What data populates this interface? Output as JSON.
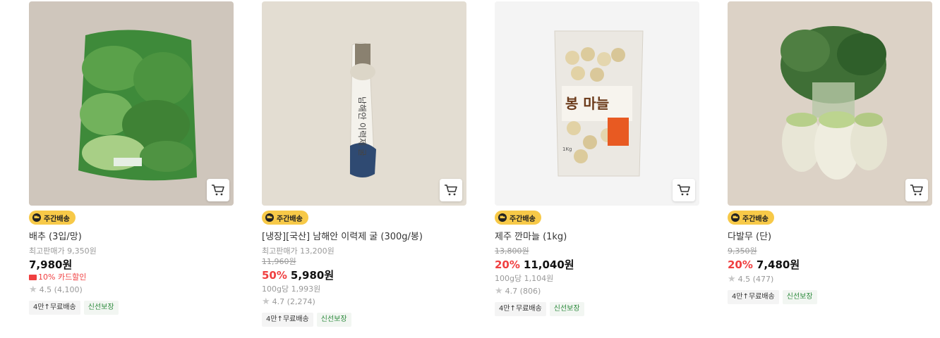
{
  "badge_label": "주간배송",
  "products": [
    {
      "name": "배추 (3입/망)",
      "ref_price": "최고판매가 9,350원",
      "price": "7,980원",
      "card_discount": "10% 카드할인",
      "rating": "4.5",
      "reviews": "(4,100)",
      "tags": [
        "4만↑무료배송",
        "신선보장"
      ]
    },
    {
      "name": "[냉장][국산] 남해안 이력제 굴 (300g/봉)",
      "ref_price": "최고판매가 13,200원",
      "original_price": "11,960원",
      "discount": "50%",
      "price": "5,980원",
      "unit_price": "100g당 1,993원",
      "rating": "4.7",
      "reviews": "(2,274)",
      "tags": [
        "4만↑무료배송",
        "신선보장"
      ],
      "package_text": "남해안 이력제 굴"
    },
    {
      "name": "제주 깐마늘 (1kg)",
      "original_price": "13,800원",
      "discount": "20%",
      "price": "11,040원",
      "unit_price": "100g당 1,104원",
      "rating": "4.7",
      "reviews": "(806)",
      "tags": [
        "4만↑무료배송",
        "신선보장"
      ],
      "package_text": "봉 마늘",
      "package_weight": "1Kg"
    },
    {
      "name": "다발무 (단)",
      "original_price": "9,350원",
      "discount": "20%",
      "price": "7,480원",
      "rating": "4.5",
      "reviews": "(477)",
      "tags": [
        "4만↑무료배송",
        "신선보장"
      ]
    }
  ],
  "colors": {
    "badge": "#f7c948",
    "discount": "#f03f40",
    "fresh_tag": "#2c8a3c"
  },
  "icons": [
    "cart-icon",
    "truck-icon",
    "star-icon",
    "credit-card-icon"
  ]
}
